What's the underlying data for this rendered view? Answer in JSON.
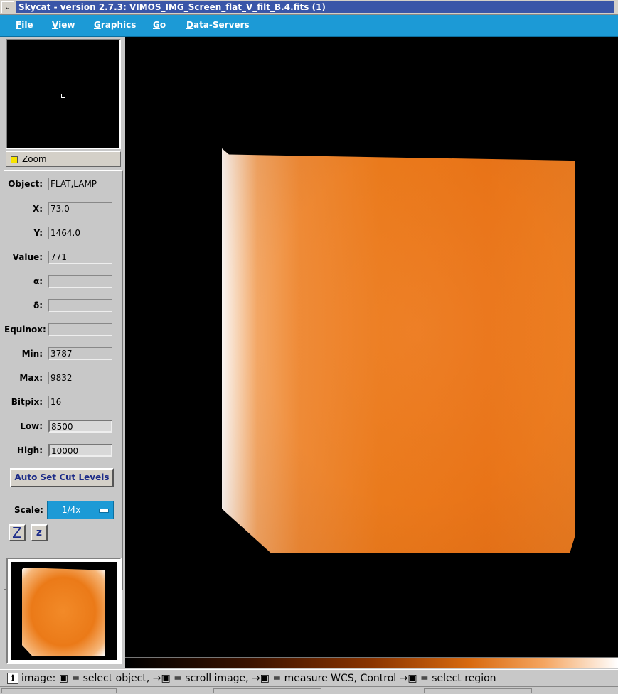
{
  "window": {
    "title": "Skycat - version 2.7.3: VIMOS_IMG_Screen_flat_V_filt_B.4.fits (1)",
    "menu_icon": "chevron-down-icon"
  },
  "menu": [
    "File",
    "View",
    "Graphics",
    "Go",
    "Data-Servers"
  ],
  "zoom": {
    "label": "Zoom"
  },
  "fields": {
    "object": {
      "label": "Object:",
      "value": "FLAT,LAMP"
    },
    "x": {
      "label": "X:",
      "value": "73.0"
    },
    "y": {
      "label": "Y:",
      "value": "1464.0"
    },
    "value": {
      "label": "Value:",
      "value": "771"
    },
    "alpha": {
      "label": "α:",
      "value": ""
    },
    "delta": {
      "label": "δ:",
      "value": ""
    },
    "equinox": {
      "label": "Equinox:",
      "value": ""
    },
    "min": {
      "label": "Min:",
      "value": "3787"
    },
    "max": {
      "label": "Max:",
      "value": "9832"
    },
    "bitpix": {
      "label": "Bitpix:",
      "value": "16"
    },
    "low": {
      "label": "Low:",
      "value": "8500"
    },
    "high": {
      "label": "High:",
      "value": "10000"
    }
  },
  "auto_cut_button": "Auto Set Cut Levels",
  "scale": {
    "label": "Scale:",
    "value": "1/4x"
  },
  "zoom_in_label": "Z",
  "zoom_out_label": "z",
  "status": {
    "icon": "i",
    "text": "image: ▣ = select object, →▣ = scroll image, →▣ = measure WCS, Control →▣ = select region"
  },
  "colors": {
    "menubar": "#1c9ad6",
    "title_bg": "#3a56a8",
    "image_orange": "#ea7a1c",
    "panel": "#c8c8c8"
  }
}
